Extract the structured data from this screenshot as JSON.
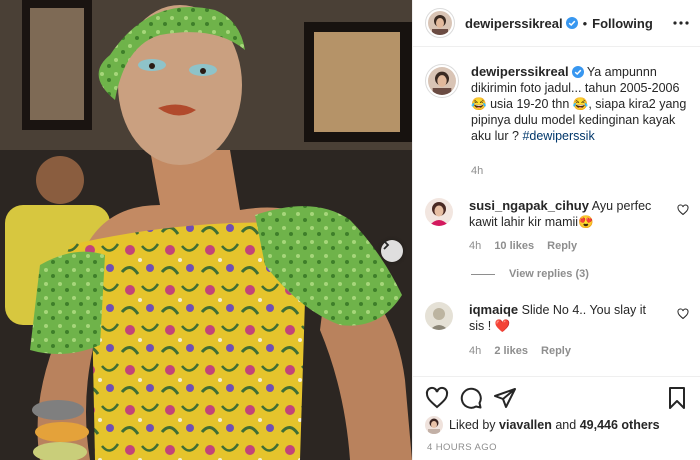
{
  "header": {
    "username": "dewiperssikreal",
    "verified": true,
    "separator": "•",
    "follow_state": "Following",
    "more_icon": "more-horizontal-icon"
  },
  "caption": {
    "username": "dewiperssikreal",
    "text_part1": "Ya ampunnn dikirimin foto jadul... tahun 2005-2006",
    "emoji1": "😂",
    "text_part2": "usia 19-20 thn",
    "emoji2": "😂",
    "text_part3": ", siapa kira2 yang pipinya dulu model kedinginan kayak aku lur ?",
    "hashtag": "#dewiperssik",
    "time": "4h"
  },
  "comments": [
    {
      "username": "susi_ngapak_cihuy",
      "text": "Ayu perfec kawit lahir kir mamii",
      "emoji": "😍",
      "time": "4h",
      "likes": "10 likes",
      "reply": "Reply",
      "view_replies": "View replies (3)"
    },
    {
      "username": "iqmaiqe",
      "text": "Slide No 4.. You slay it sis !",
      "emoji": "❤️",
      "time": "4h",
      "likes": "2 likes",
      "reply": "Reply"
    }
  ],
  "actions": {
    "like_icon": "heart-icon",
    "comment_icon": "comment-icon",
    "share_icon": "send-icon",
    "save_icon": "bookmark-icon"
  },
  "likes": {
    "prefix": "Liked by",
    "user": "viavallen",
    "joiner": "and",
    "others": "49,446 others"
  },
  "timestamp": "4 HOURS AGO",
  "colors": {
    "verified_blue": "#3897f0",
    "link_blue": "#00376b",
    "meta_gray": "#8e8e8e",
    "heart_red": "#ed4956"
  }
}
